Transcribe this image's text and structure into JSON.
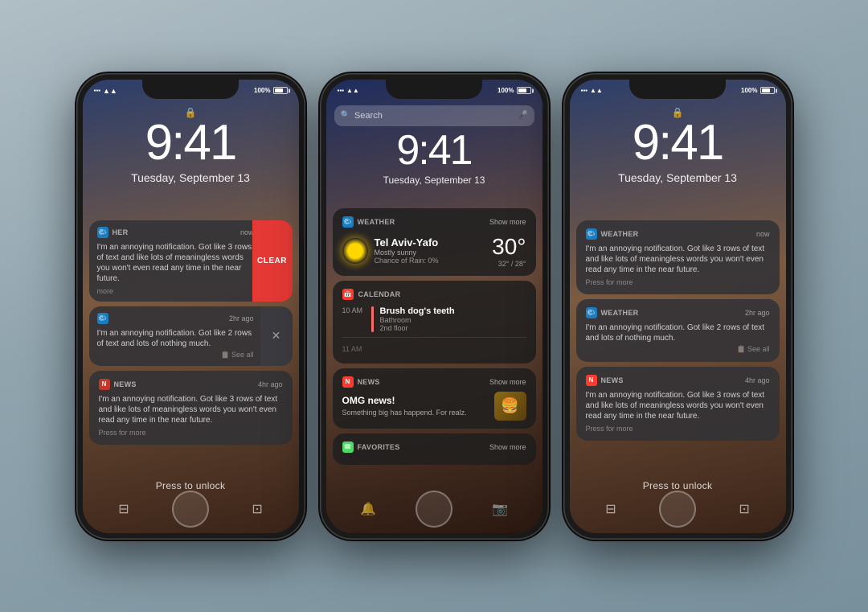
{
  "phones": [
    {
      "id": "phone1",
      "type": "lockscreen_notifications_swipe",
      "time": "9:41",
      "date": "Tuesday, September 13",
      "status": {
        "left": "●●● ▲▲ ◆ ☁",
        "right": "100%"
      },
      "notifications": [
        {
          "app": "WEATHER",
          "time": "now",
          "title": "",
          "body": "I'm an annoying notification. Got like 3 rows of text and like lots of meaningless words you won't even read any time in the near future.",
          "action": "more",
          "swiped": true,
          "clear": "CLEAR"
        },
        {
          "app": "WEATHER",
          "time": "2hr ago",
          "title": "",
          "body": "I'm an annoying notification. Got like 2 rows of text and lots of nothing much.",
          "see_all": "See all",
          "swiped": true
        },
        {
          "app": "NEWS",
          "time": "4hr ago",
          "title": "",
          "body": "I'm an annoying notification. Got like 3 rows of text and like lots of meaningless words you won't even read any time in the near future.",
          "action": "Press for more"
        }
      ],
      "press_unlock": "Press to unlock"
    },
    {
      "id": "phone2",
      "type": "spotlight_search",
      "search_placeholder": "Search",
      "time": "9:41",
      "date": "Tuesday, September 13",
      "weather": {
        "label": "WEATHER",
        "show_more": "Show more",
        "city": "Tel Aviv-Yafo",
        "desc": "Mostly sunny",
        "chance": "Chance of Rain: 0%",
        "temp": "30°",
        "range": "32° / 28°"
      },
      "calendar": {
        "label": "CALENDAR",
        "event_title": "Brush dog's teeth",
        "event_time": "10 AM",
        "event_location": "Bathroom",
        "event_floor": "2nd floor"
      },
      "news_widget": {
        "label": "NEWS",
        "show_more": "Show more",
        "title": "OMG news!",
        "body": "Something big has happend. For realz."
      },
      "favorites": {
        "label": "FAVORITES",
        "show_more": "Show more"
      }
    },
    {
      "id": "phone3",
      "type": "lockscreen_notifications",
      "time": "9:41",
      "date": "Tuesday, September 13",
      "notifications": [
        {
          "app": "WEATHER",
          "time": "now",
          "body": "I'm an annoying notification. Got like 3 rows of text and like lots of meaningless words you won't even read any time in the near future.",
          "action": "Press for more"
        },
        {
          "app": "WEATHER",
          "time": "2hr ago",
          "body": "I'm an annoying notification. Got like 2 rows of text and lots of nothing much.",
          "see_all": "See all"
        },
        {
          "app": "NEWS",
          "time": "4hr ago",
          "body": "I'm an annoying notification. Got like 3 rows of text and like lots of meaningless words you won't even read any time in the near future.",
          "action": "Press for more"
        }
      ],
      "press_unlock": "Press to unlock"
    }
  ],
  "labels": {
    "clear": "CLEAR",
    "press_more": "Press for more",
    "see_all": "See all",
    "show_more": "Show more",
    "search": "Search"
  }
}
